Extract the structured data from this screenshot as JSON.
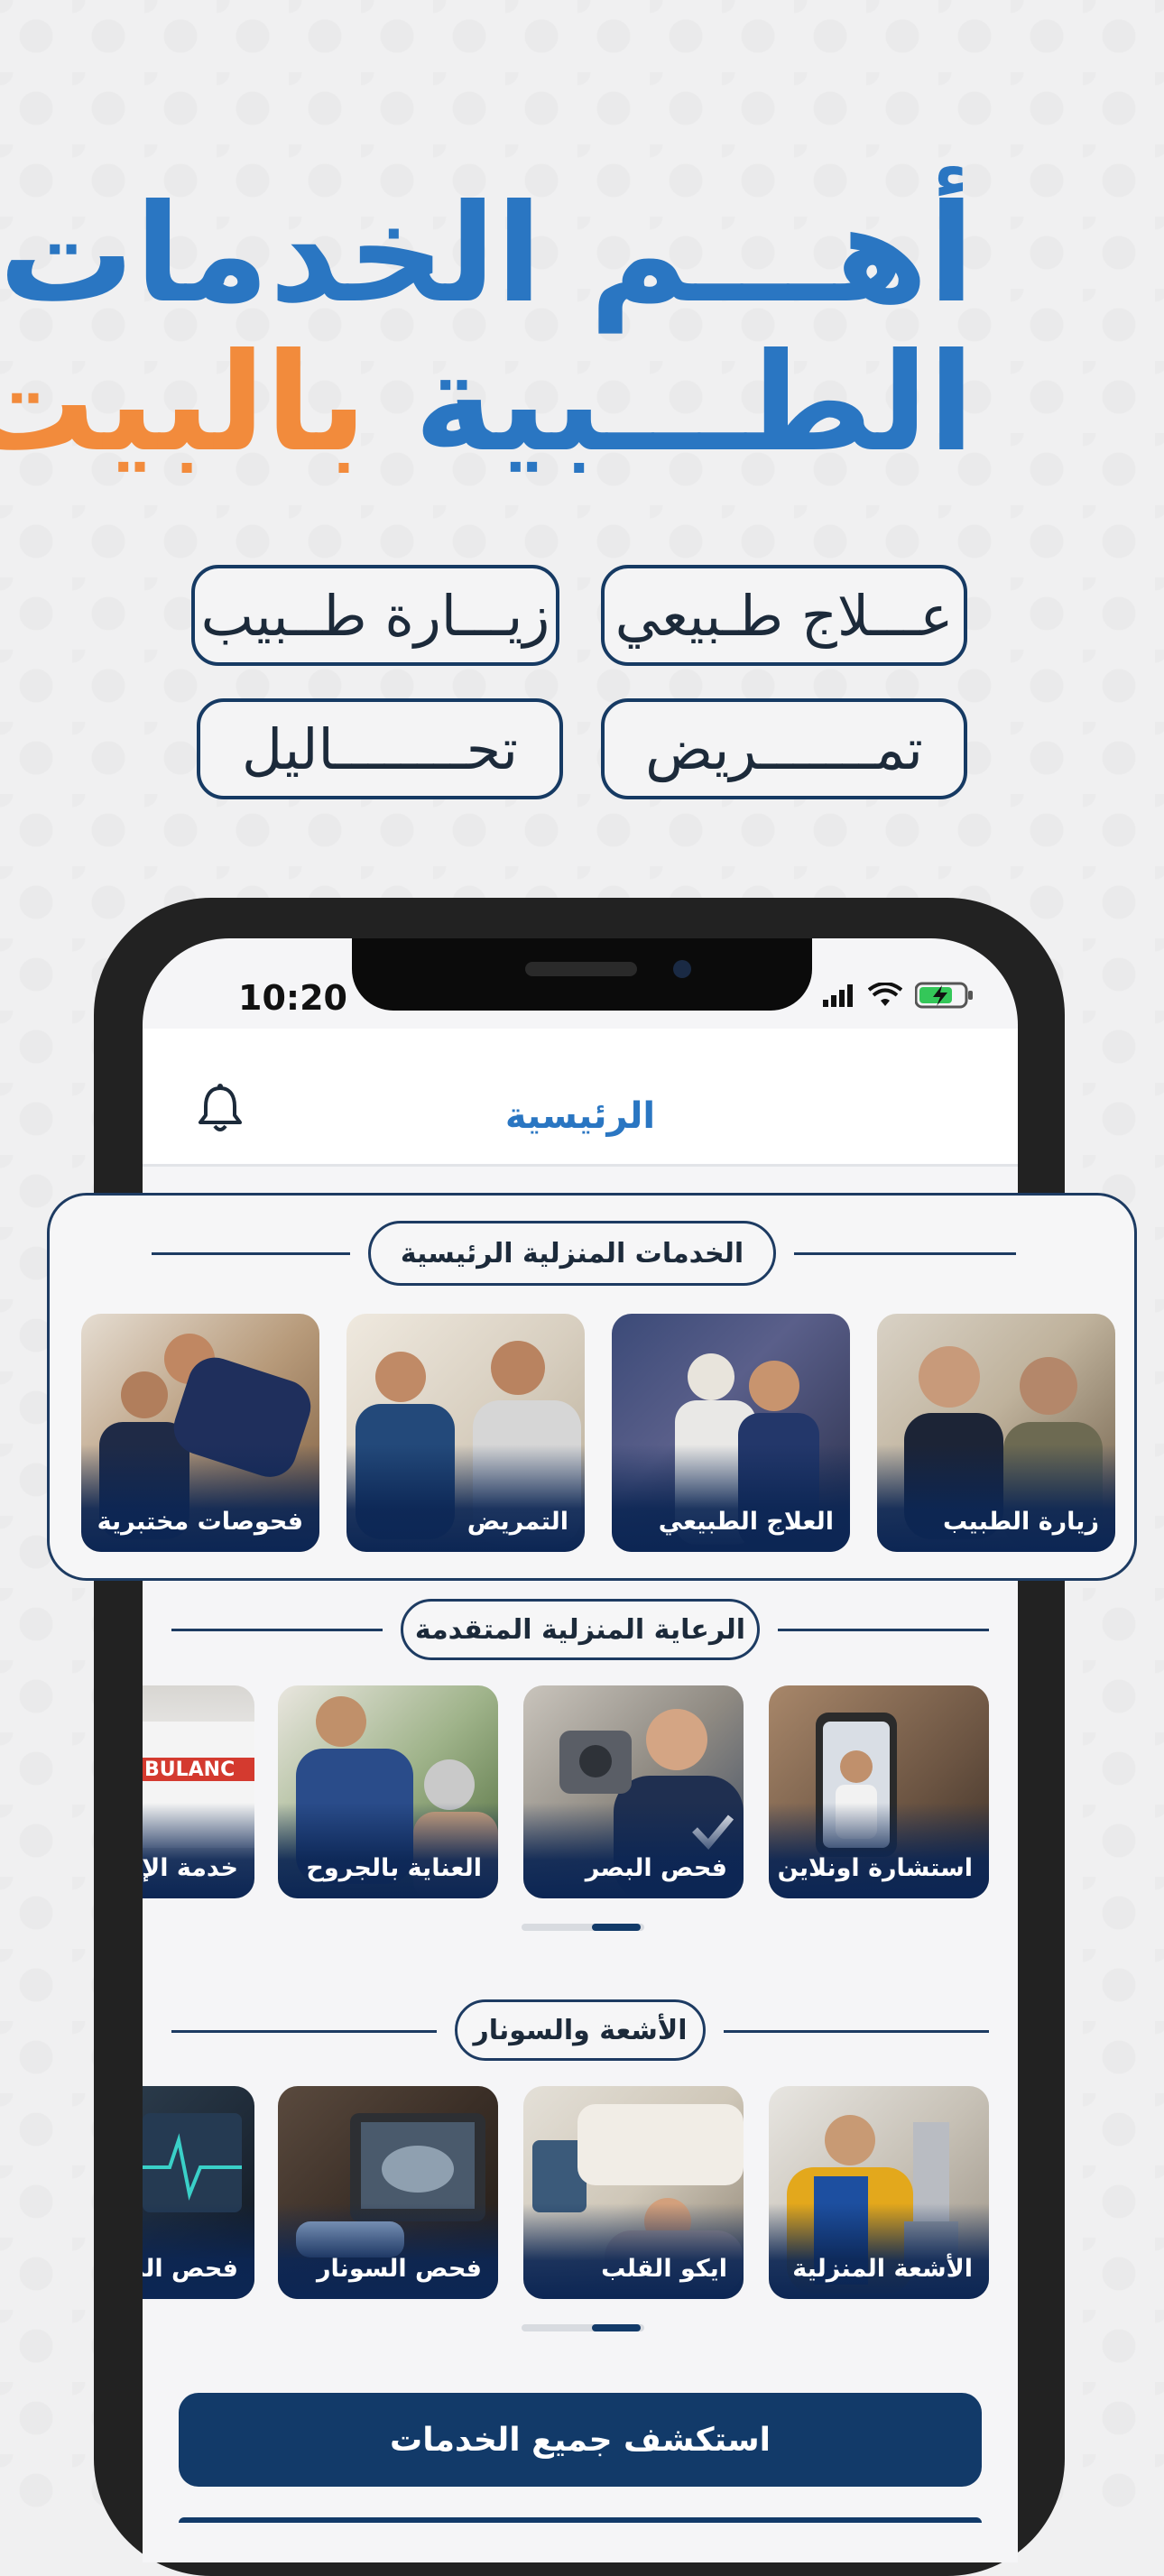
{
  "hero": {
    "line1": "أهـــم الخدمات",
    "line2_blue": "الطـــبية ",
    "line2_orange": "بالبيت"
  },
  "pills": [
    "عـــلاج طـبيعي",
    "زيـــارة طــبيب",
    "تمـــــــريض",
    "تحــــــــاليل"
  ],
  "status": {
    "time": "10:20"
  },
  "header": {
    "title": "الرئيسية",
    "bell_icon": "bell-icon"
  },
  "main_services": {
    "title": "الخدمات المنزلية الرئيسية",
    "items": [
      "زيارة الطبيب",
      "العلاج الطبيعي",
      "التمريض",
      "فحوصات مختبرية"
    ]
  },
  "advanced_care": {
    "title": "الرعاية المنزلية المتقدمة",
    "items": [
      "استشارة اونلاين",
      "فحص البصر",
      "العناية بالجروح",
      "خدمة الإس"
    ]
  },
  "radiology": {
    "title": "الأشعة والسونار",
    "items": [
      "الأشعة المنزلية",
      "ايكو القلب",
      "فحص السونار",
      "فحص الد"
    ]
  },
  "cta": {
    "label": "استكشف جميع الخدمات"
  },
  "colors": {
    "primary_blue": "#2a76c2",
    "accent_orange": "#f28b3c",
    "navy": "#123a69"
  }
}
